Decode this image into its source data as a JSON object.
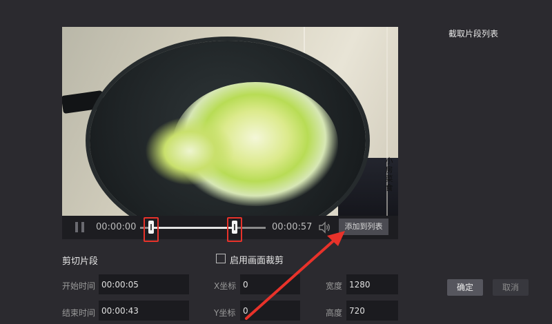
{
  "right_panel": {
    "title": "截取片段列表"
  },
  "player": {
    "current_time": "00:00:00",
    "total_time": "00:00:57",
    "add_button": "添加到列表",
    "watermark": "小房菜食"
  },
  "clip": {
    "title": "剪切片段",
    "start_label": "开始时间",
    "start_value": "00:00:05",
    "end_label": "结束时间",
    "end_value": "00:00:43"
  },
  "crop": {
    "checkbox_label": "启用画面裁剪",
    "x_label": "X坐标",
    "x_value": "0",
    "y_label": "Y坐标",
    "y_value": "0",
    "width_label": "宽度",
    "width_value": "1280",
    "height_label": "高度",
    "height_value": "720"
  },
  "actions": {
    "ok": "确定",
    "cancel": "取消"
  },
  "colors": {
    "background": "#2b2a2f",
    "highlight": "#e8322a",
    "button": "#4b4b52"
  },
  "icons": {
    "play_pause": "pause-icon",
    "volume": "speaker-icon"
  },
  "timeline": {
    "start_fraction": 0.09,
    "end_fraction": 0.75
  }
}
